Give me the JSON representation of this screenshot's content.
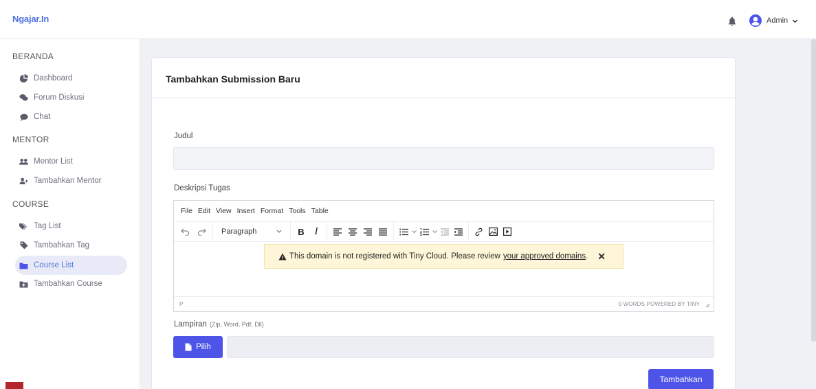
{
  "brand": "Ngajar.In",
  "user": {
    "name": "Admin"
  },
  "sidebar": {
    "sections": [
      {
        "title": "BERANDA",
        "items": [
          {
            "label": "Dashboard",
            "icon": "chart-pie-icon"
          },
          {
            "label": "Forum Diskusi",
            "icon": "comments-icon"
          },
          {
            "label": "Chat",
            "icon": "comment-icon"
          }
        ]
      },
      {
        "title": "MENTOR",
        "items": [
          {
            "label": "Mentor List",
            "icon": "users-icon"
          },
          {
            "label": "Tambahkan Mentor",
            "icon": "user-plus-icon"
          }
        ]
      },
      {
        "title": "COURSE",
        "items": [
          {
            "label": "Tag List",
            "icon": "tags-icon"
          },
          {
            "label": "Tambahkan Tag",
            "icon": "tag-icon"
          },
          {
            "label": "Course List",
            "icon": "folder-icon",
            "active": true
          },
          {
            "label": "Tambahkan Course",
            "icon": "folder-plus-icon"
          }
        ]
      }
    ]
  },
  "form": {
    "title": "Tambahkan Submission Baru",
    "judul_label": "Judul",
    "judul_value": "",
    "deskripsi_label": "Deskripsi Tugas",
    "lampiran_label": "Lampiran",
    "lampiran_hint": "(Zip, Word, Pdf, Dll)",
    "pilih_label": "Pilih",
    "submit_label": "Tambahkan"
  },
  "editor": {
    "menu": [
      "File",
      "Edit",
      "View",
      "Insert",
      "Format",
      "Tools",
      "Table"
    ],
    "block_format": "Paragraph",
    "warning_text": "This domain is not registered with Tiny Cloud. Please review",
    "warning_link": "your approved domains",
    "warning_period": ".",
    "status_path": "P",
    "status_words": "0 WORDS  POWERED BY TINY"
  },
  "colors": {
    "accent": "#4e73df",
    "button": "#4e54e8",
    "warning_bg": "#fff6d9"
  }
}
